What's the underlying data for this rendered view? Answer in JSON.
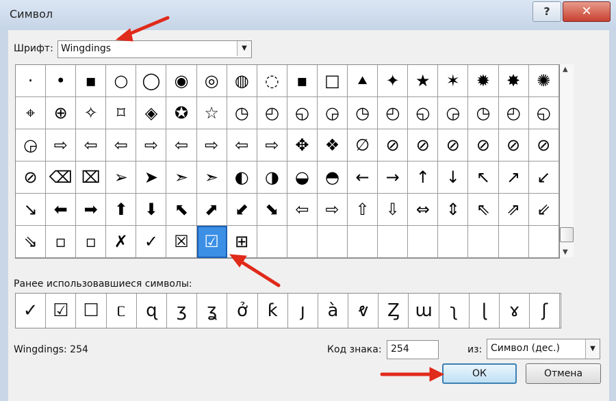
{
  "window": {
    "title": "Символ",
    "help_label": "?",
    "close_label": "✕"
  },
  "font": {
    "label": "Шрифт:",
    "value": "Wingdings"
  },
  "symbol_grid": {
    "rows": [
      [
        "·",
        "•",
        "▪",
        "○",
        "◯",
        "◉",
        "◎",
        "◍",
        "◌",
        "▪",
        "□",
        "⯅",
        "✦",
        "★",
        "✶",
        "✹",
        "✸",
        "✺"
      ],
      [
        "⌖",
        "⊕",
        "✧",
        "⌑",
        "◈",
        "✪",
        "☆",
        "◷",
        "◴",
        "◵",
        "◶",
        "◷",
        "◴",
        "◵",
        "◶",
        "◷",
        "◴",
        "◵"
      ],
      [
        "◶",
        "⇨",
        "⇦",
        "⇦",
        "⇨",
        "⇦",
        "⇨",
        "⇦",
        "⇨",
        "✥",
        "❖",
        "∅",
        "⊘",
        "⊘",
        "⊘",
        "⊘",
        "⊘",
        "⊘"
      ],
      [
        "⊘",
        "⌫",
        "⌧",
        "➢",
        "➤",
        "➣",
        "➣",
        "◐",
        "◑",
        "◒",
        "◓",
        "←",
        "→",
        "↑",
        "↓",
        "↖",
        "↗",
        "↙"
      ],
      [
        "↘",
        "⬅",
        "➡",
        "⬆",
        "⬇",
        "⬉",
        "⬈",
        "⬋",
        "⬊",
        "⇦",
        "⇨",
        "⇧",
        "⇩",
        "⇔",
        "⇕",
        "⇖",
        "⇗",
        "⇙"
      ],
      [
        "⇘",
        "▫",
        "▫",
        "✗",
        "✓",
        "☒",
        "☑",
        "⊞",
        "",
        "",
        "",
        "",
        "",
        "",
        "",
        "",
        "",
        ""
      ]
    ],
    "selected_row": 5,
    "selected_col": 6
  },
  "recent": {
    "label": "Ранее использовавшиеся символы:",
    "symbols": [
      "✓",
      "☑",
      "☐",
      "ᥴ",
      "ɋ",
      "ʒ",
      "ʓ",
      "ở",
      "ƙ",
      "ȷ",
      "à",
      "ⱴ",
      "Ȥ",
      "ɯ",
      "ʅ",
      "ɭ",
      "ɤ",
      "ʃ"
    ]
  },
  "status": {
    "text": "Wingdings: 254"
  },
  "char_code": {
    "label": "Код знака:",
    "value": "254"
  },
  "from": {
    "label": "из:",
    "value": "Символ (дес.)"
  },
  "buttons": {
    "ok": "ОК",
    "cancel": "Отмена"
  },
  "accent_colors": {
    "selection": "#3b8fe5",
    "annotation_arrow": "#e02a1a"
  }
}
